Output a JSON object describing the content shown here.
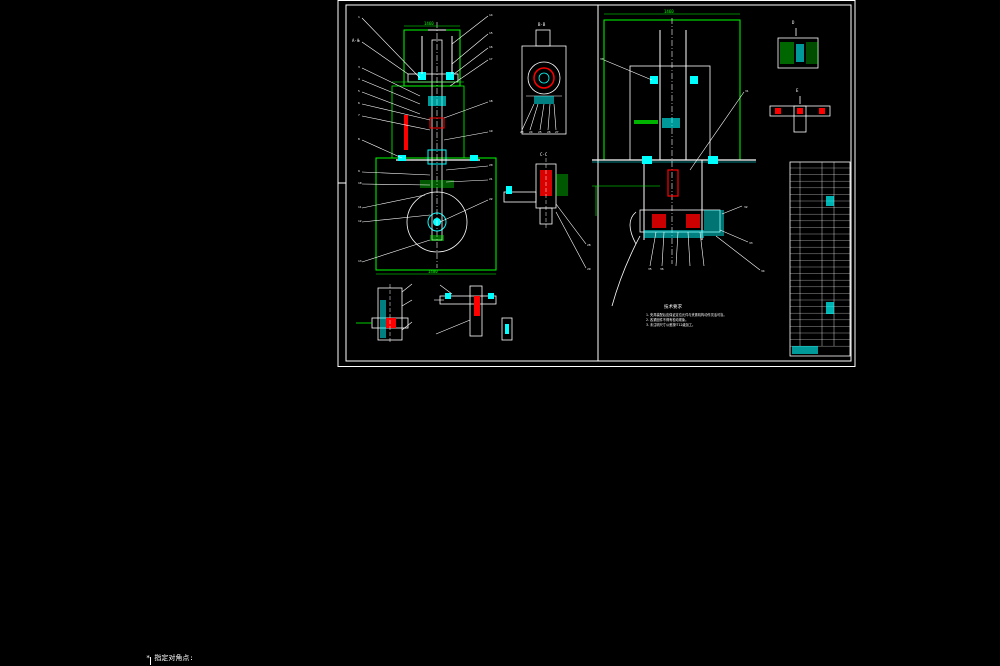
{
  "drawing": {
    "section_labels": [
      "A-A",
      "B-B",
      "C-C",
      "D",
      "E"
    ],
    "notes_title": "技术要求",
    "notes": [
      "1. 夹具装配后应保证定位元件与夹紧机构动作灵活可靠。",
      "2. 各紧固件不得有松动现象。",
      "3. 未注明尺寸公差按IT12级加工。"
    ],
    "part_callouts": [
      "1",
      "2",
      "3",
      "4",
      "5",
      "6",
      "7",
      "8",
      "9",
      "10",
      "11",
      "12",
      "13",
      "14",
      "15",
      "16",
      "17",
      "18",
      "19",
      "20",
      "21",
      "22",
      "23",
      "24",
      "25",
      "26",
      "27",
      "28",
      "29",
      "30",
      "31",
      "32",
      "33",
      "34",
      "35",
      "36"
    ]
  },
  "colors": {
    "background": "#000000",
    "frame": "#ffffff",
    "outline": "#00ff00",
    "part": "#ffffff",
    "hatch": "#00ffff",
    "accent": "#ff0000",
    "dim": "#ffff00"
  },
  "command_line": "  * 指定对角点:"
}
